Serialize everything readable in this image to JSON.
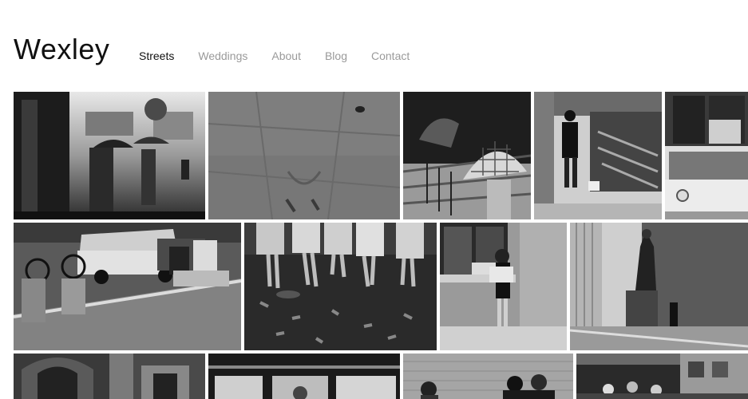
{
  "site": {
    "logo": "Wexley"
  },
  "nav": {
    "items": [
      {
        "label": "Streets",
        "active": true
      },
      {
        "label": "Weddings",
        "active": false
      },
      {
        "label": "About",
        "active": false
      },
      {
        "label": "Blog",
        "active": false
      },
      {
        "label": "Contact",
        "active": false
      }
    ]
  },
  "colors": {
    "text_primary": "#111111",
    "text_muted": "#9a9a9a",
    "background": "#ffffff"
  },
  "gallery": {
    "photos": [
      {
        "name": "photo-rainy-street-umbrellas",
        "style": "grayscale"
      },
      {
        "name": "photo-pavement-texture",
        "style": "grayscale"
      },
      {
        "name": "photo-checkered-umbrella-stairs",
        "style": "grayscale"
      },
      {
        "name": "photo-woman-with-dog-bookstall",
        "style": "grayscale"
      },
      {
        "name": "photo-vintage-car-facade",
        "style": "grayscale"
      },
      {
        "name": "photo-men-on-curb-with-bike",
        "style": "grayscale"
      },
      {
        "name": "photo-dancers-legs-leaves",
        "style": "grayscale"
      },
      {
        "name": "photo-girl-holding-baby-window",
        "style": "grayscale"
      },
      {
        "name": "photo-statue-column-building",
        "style": "grayscale"
      },
      {
        "name": "photo-old-building-arches",
        "style": "grayscale"
      },
      {
        "name": "photo-train-windows-passengers",
        "style": "grayscale"
      },
      {
        "name": "photo-people-brick-wall",
        "style": "grayscale"
      },
      {
        "name": "photo-street-crowd-market",
        "style": "grayscale"
      }
    ]
  }
}
